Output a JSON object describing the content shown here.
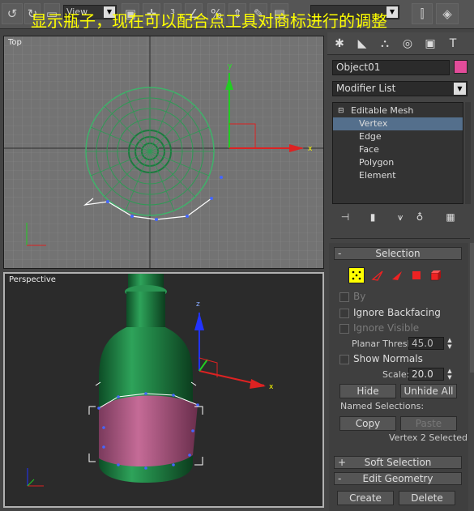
{
  "caption": "显示瓶子，现在可以配合点工具对商标进行的调整",
  "toolbar": {
    "view_dropdown": "View"
  },
  "viewports": {
    "top_label": "Top",
    "persp_label": "Perspective"
  },
  "gizmo": {
    "axis_x": "x",
    "axis_y": "y"
  },
  "panel": {
    "object_name": "Object01",
    "object_color": "#e34c9a",
    "modifier_list": "Modifier List",
    "stack": {
      "root": "Editable Mesh",
      "items": [
        "Vertex",
        "Edge",
        "Face",
        "Polygon",
        "Element"
      ],
      "selected": "Vertex"
    },
    "selection": {
      "title": "Selection",
      "by_label": "By",
      "ignore_backfacing": "Ignore Backfacing",
      "ignore_visible": "Ignore Visible",
      "planar_thresh_label": "Planar Thresh:",
      "planar_thresh_value": "45.0",
      "show_normals": "Show Normals",
      "scale_label": "Scale:",
      "scale_value": "20.0",
      "hide": "Hide",
      "unhide_all": "Unhide All",
      "named_selections": "Named Selections:",
      "copy": "Copy",
      "paste": "Paste",
      "status": "Vertex 2 Selected"
    },
    "soft_selection": "Soft Selection",
    "edit_geometry": "Edit Geometry",
    "create": "Create",
    "delete": "Delete"
  }
}
